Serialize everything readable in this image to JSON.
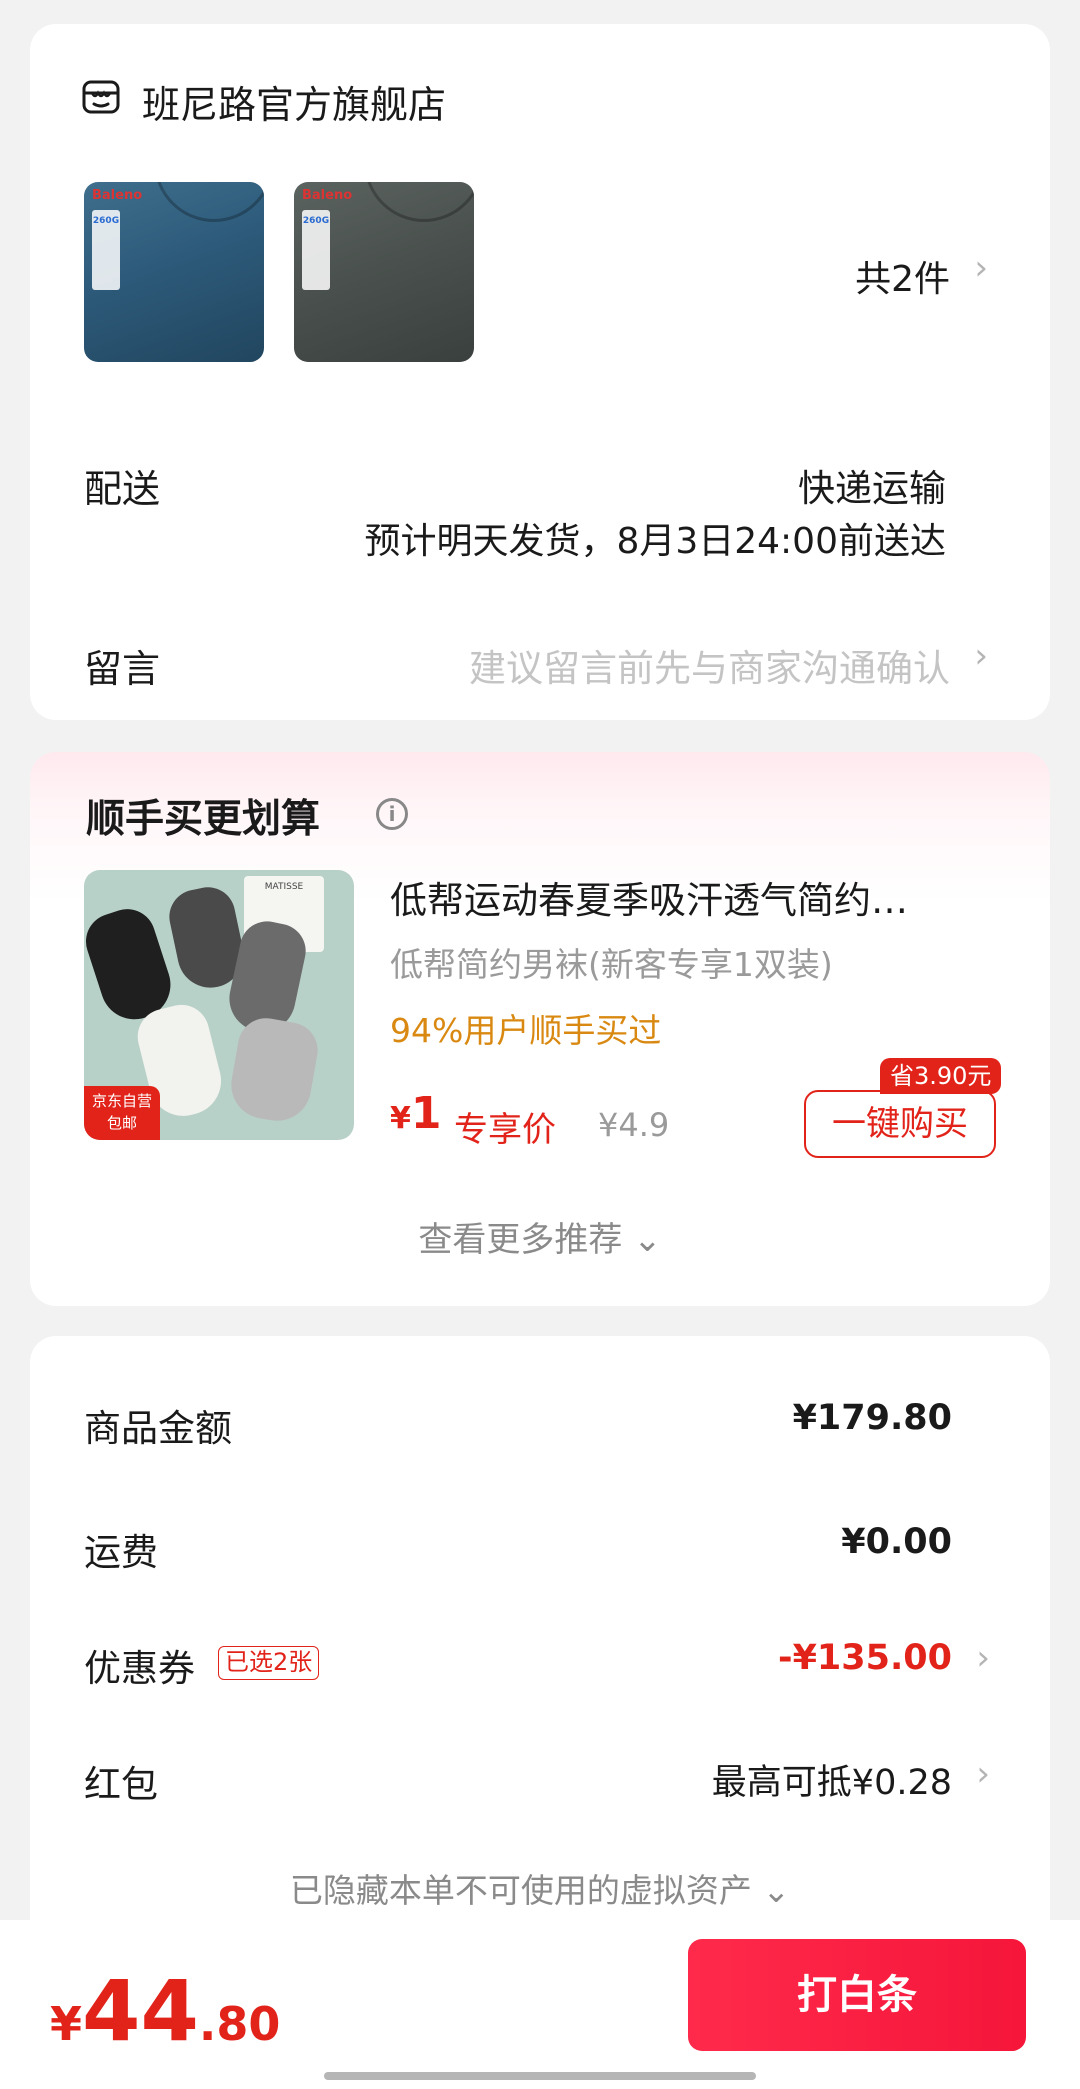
{
  "store": {
    "name": "班尼路官方旗舰店",
    "product_thumbs": [
      {
        "brand": "Baleno",
        "spec": "260G",
        "color": "#2d5a7a"
      },
      {
        "brand": "Baleno",
        "spec": "260G",
        "color": "#4a514e"
      }
    ],
    "count_label": "共2件",
    "delivery_label": "配送",
    "delivery_method": "快递运输",
    "delivery_eta": "预计明天发货，8月3日24:00前送达",
    "note_label": "留言",
    "note_placeholder": "建议留言前先与商家沟通确认"
  },
  "recommend": {
    "title": "顺手买更划算",
    "item": {
      "name": "低帮运动春夏季吸汗透气简约…",
      "subtitle": "低帮简约男袜(新客专享1双装)",
      "stat": "94%用户顺手买过",
      "currency": "¥",
      "price": "1",
      "price_label": "专享价",
      "original_price": "¥4.9",
      "save_badge": "省3.90元",
      "buy_label": "一键购买",
      "image_tag_line1": "京东自营",
      "image_tag_line2": "包邮",
      "image_box_text": "MATISSE"
    },
    "more_label": "查看更多推荐 ⌄"
  },
  "summary": {
    "goods_label": "商品金额",
    "goods_value": "¥179.80",
    "shipping_label": "运费",
    "shipping_value": "¥0.00",
    "coupon_label": "优惠券",
    "coupon_tag": "已选2张",
    "coupon_value": "-¥135.00",
    "redpacket_label": "红包",
    "redpacket_value": "最高可抵¥0.28",
    "hidden_assets_label": "已隐藏本单不可使用的虚拟资产 ⌄"
  },
  "bottom": {
    "currency": "¥",
    "total_int": "44",
    "total_dec": ".80",
    "pay_label": "打白条"
  },
  "colors": {
    "accent_red": "#e2231a",
    "pay_button": "#f5163a",
    "stat_orange": "#d98912"
  },
  "icons": {
    "store": "store-icon",
    "chevron": "›",
    "info": "i"
  }
}
